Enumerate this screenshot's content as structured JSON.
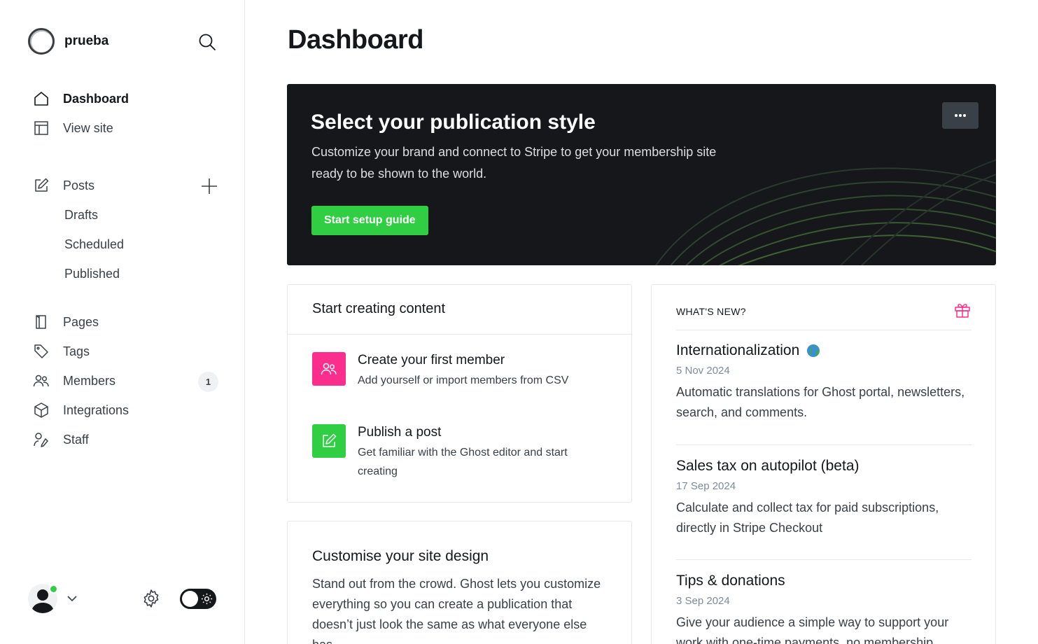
{
  "site": {
    "name": "prueba"
  },
  "nav": {
    "dashboard": "Dashboard",
    "view_site": "View site",
    "posts": "Posts",
    "drafts": "Drafts",
    "scheduled": "Scheduled",
    "published": "Published",
    "pages": "Pages",
    "tags": "Tags",
    "members": "Members",
    "members_count": "1",
    "integrations": "Integrations",
    "staff": "Staff"
  },
  "icons": {
    "search": "search-icon",
    "add_post": "plus-icon",
    "settings": "gear-icon",
    "theme": "sun-icon",
    "gift": "gift-icon"
  },
  "colors": {
    "accent": "#30cf43",
    "pink": "#fb2d8d",
    "dark": "#15171a"
  },
  "main": {
    "title": "Dashboard",
    "banner": {
      "title": "Select your publication style",
      "description": "Customize your brand and connect to Stripe to get your membership site ready to be shown to the world.",
      "button": "Start setup guide",
      "menu": "•••"
    },
    "start": {
      "heading": "Start creating content",
      "tasks": [
        {
          "title": "Create your first member",
          "desc": "Add yourself or import members from CSV"
        },
        {
          "title": "Publish a post",
          "desc": "Get familiar with the Ghost editor and start creating"
        }
      ]
    },
    "design": {
      "title": "Customise your site design",
      "text": "Stand out from the crowd. Ghost lets you customize everything so you can create a publication that doesn’t just look the same as what everyone else has."
    },
    "news": {
      "heading": "WHAT'S NEW?",
      "items": [
        {
          "title": "Internationalization",
          "date": "5 Nov 2024",
          "text": "Automatic translations for Ghost portal, newsletters, search, and comments."
        },
        {
          "title": "Sales tax on autopilot (beta)",
          "date": "17 Sep 2024",
          "text": "Calculate and collect tax for paid subscriptions, directly in Stripe Checkout"
        },
        {
          "title": "Tips & donations",
          "date": "3 Sep 2024",
          "text": "Give your audience a simple way to support your work with one-time payments, no membership required."
        }
      ]
    }
  }
}
